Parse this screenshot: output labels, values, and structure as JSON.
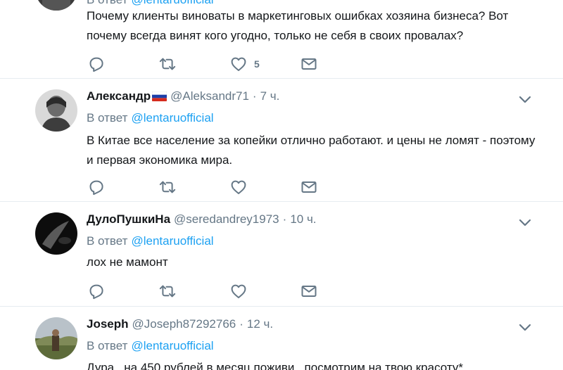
{
  "colors": {
    "link": "#1da1f2",
    "muted": "#657786",
    "text": "#14171a",
    "divider": "#e6ecf0"
  },
  "tweets": [
    {
      "reply_prefix": "В ответ",
      "mention": "@lentaruofficial",
      "text": "Почему клиенты виноваты в маркетинговых ошибках хозяина бизнеса? Вот почему всегда винят кого угодно, только не себя в своих провалах?",
      "like_count": "5"
    },
    {
      "name": "Александр",
      "flag_icon": "russia-flag-icon",
      "handle": "@Aleksandr71",
      "dot": "·",
      "time": "7 ч.",
      "reply_prefix": "В ответ",
      "mention": "@lentaruofficial",
      "text": "В Китае все население за копейки отлично работают. и цены не ломят - поэтому и первая экономика мира."
    },
    {
      "name": "ДулоПушкиНа",
      "handle": "@seredandrey1973",
      "dot": "·",
      "time": "10 ч.",
      "reply_prefix": "В ответ",
      "mention": "@lentaruofficial",
      "text": "лох не мамонт"
    },
    {
      "name": "Joseph",
      "handle": "@Joseph87292766",
      "dot": "·",
      "time": "12 ч.",
      "reply_prefix": "В ответ",
      "mention": "@lentaruofficial",
      "text": "Дура , на 450 рублей в месяц поживи , посмотрим на твою красоту*"
    }
  ]
}
